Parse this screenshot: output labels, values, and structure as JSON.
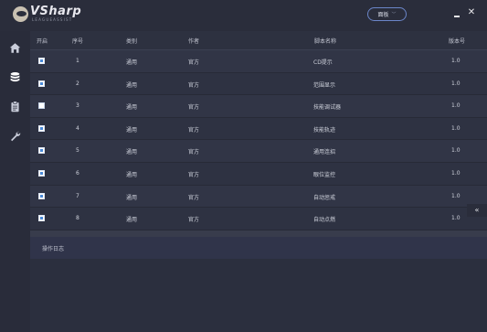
{
  "app": {
    "name": "VSharp",
    "subtitle": "LEAGUEASSIST"
  },
  "titlebar": {
    "panel_label": "面板",
    "min_label": "—",
    "close_label": "✕"
  },
  "sidebar": {
    "items": [
      {
        "icon": "home-icon"
      },
      {
        "icon": "database-icon"
      },
      {
        "icon": "clipboard-icon"
      },
      {
        "icon": "wrench-icon"
      }
    ]
  },
  "table": {
    "headers": {
      "enabled": "开启",
      "index": "序号",
      "category": "类别",
      "author": "作者",
      "script_name": "脚本名称",
      "version": "版本号"
    },
    "rows": [
      {
        "checked": true,
        "index": "1",
        "category": "通用",
        "author": "官方",
        "name": "CD提示",
        "version": "1.0"
      },
      {
        "checked": true,
        "index": "2",
        "category": "通用",
        "author": "官方",
        "name": "范围显示",
        "version": "1.0"
      },
      {
        "checked": false,
        "index": "3",
        "category": "通用",
        "author": "官方",
        "name": "技能调试器",
        "version": "1.0"
      },
      {
        "checked": true,
        "index": "4",
        "category": "通用",
        "author": "官方",
        "name": "技能轨迹",
        "version": "1.0"
      },
      {
        "checked": true,
        "index": "5",
        "category": "通用",
        "author": "官方",
        "name": "通用连招",
        "version": "1.0"
      },
      {
        "checked": true,
        "index": "6",
        "category": "通用",
        "author": "官方",
        "name": "眼位监控",
        "version": "1.0"
      },
      {
        "checked": true,
        "index": "7",
        "category": "通用",
        "author": "官方",
        "name": "自动惩戒",
        "version": "1.0"
      },
      {
        "checked": true,
        "index": "8",
        "category": "通用",
        "author": "官方",
        "name": "自动点燃",
        "version": "1.0"
      }
    ]
  },
  "log": {
    "title": "操作日志"
  },
  "collapse_label": "«",
  "colors": {
    "background": "#2b2f3e",
    "accent": "#4a8ad8",
    "panel_border": "#6b86c9"
  }
}
